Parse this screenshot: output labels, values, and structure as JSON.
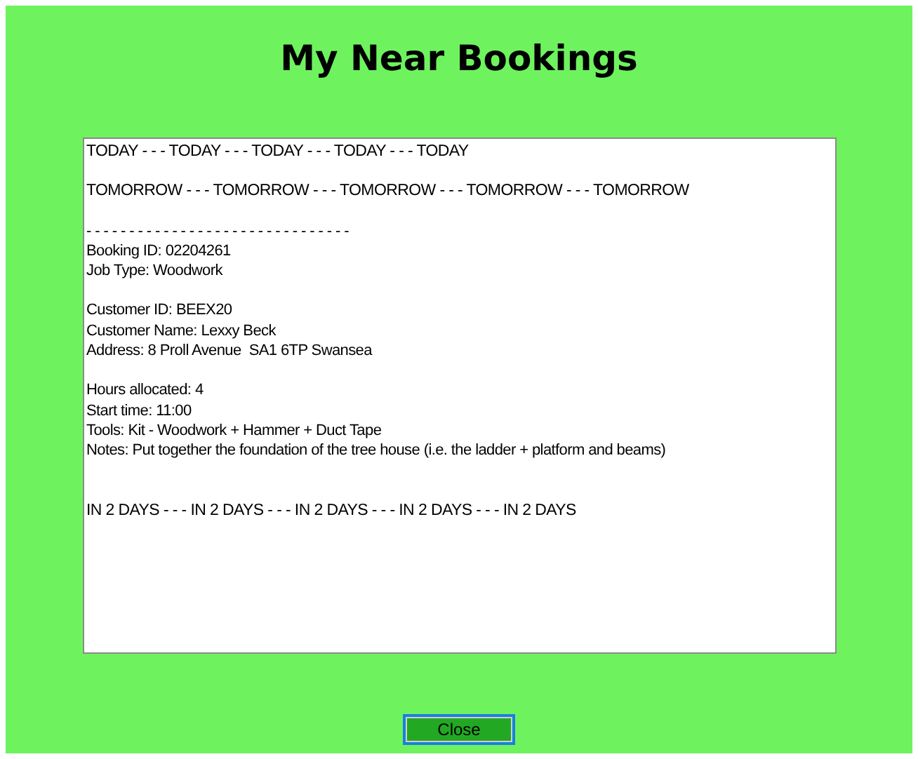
{
  "window": {
    "title": "My Near Bookings"
  },
  "bookings_text": {
    "blocks": [
      {
        "kind": "banner",
        "lines": [
          "TODAY - - - TODAY - - - TODAY - - - TODAY - - - TODAY"
        ]
      },
      {
        "kind": "banner",
        "lines": [
          "TOMORROW - - - TOMORROW - - - TOMORROW - - - TOMORROW - - - TOMORROW"
        ]
      },
      {
        "kind": "details",
        "lines": [
          "- - - - - - - - - - - - - - - - - - - - - - - - - - - - - - -",
          "Booking ID: 02204261",
          "Job Type: Woodwork"
        ]
      },
      {
        "kind": "details",
        "lines": [
          "Customer ID: BEEX20",
          "Customer Name: Lexxy Beck",
          "Address: 8 Proll Avenue  SA1 6TP Swansea"
        ]
      },
      {
        "kind": "details",
        "lines": [
          "Hours allocated: 4",
          "Start time: 11:00",
          "Tools: Kit - Woodwork + Hammer + Duct Tape",
          "Notes: Put together the foundation of the tree house (i.e. the ladder + platform and beams)"
        ]
      },
      {
        "kind": "banner",
        "lines": [
          "IN 2 DAYS - - - IN 2 DAYS - - - IN 2 DAYS - - - IN 2 DAYS - - - IN 2 DAYS"
        ]
      }
    ]
  },
  "buttons": [
    {
      "label": "Close",
      "focused": true
    }
  ]
}
